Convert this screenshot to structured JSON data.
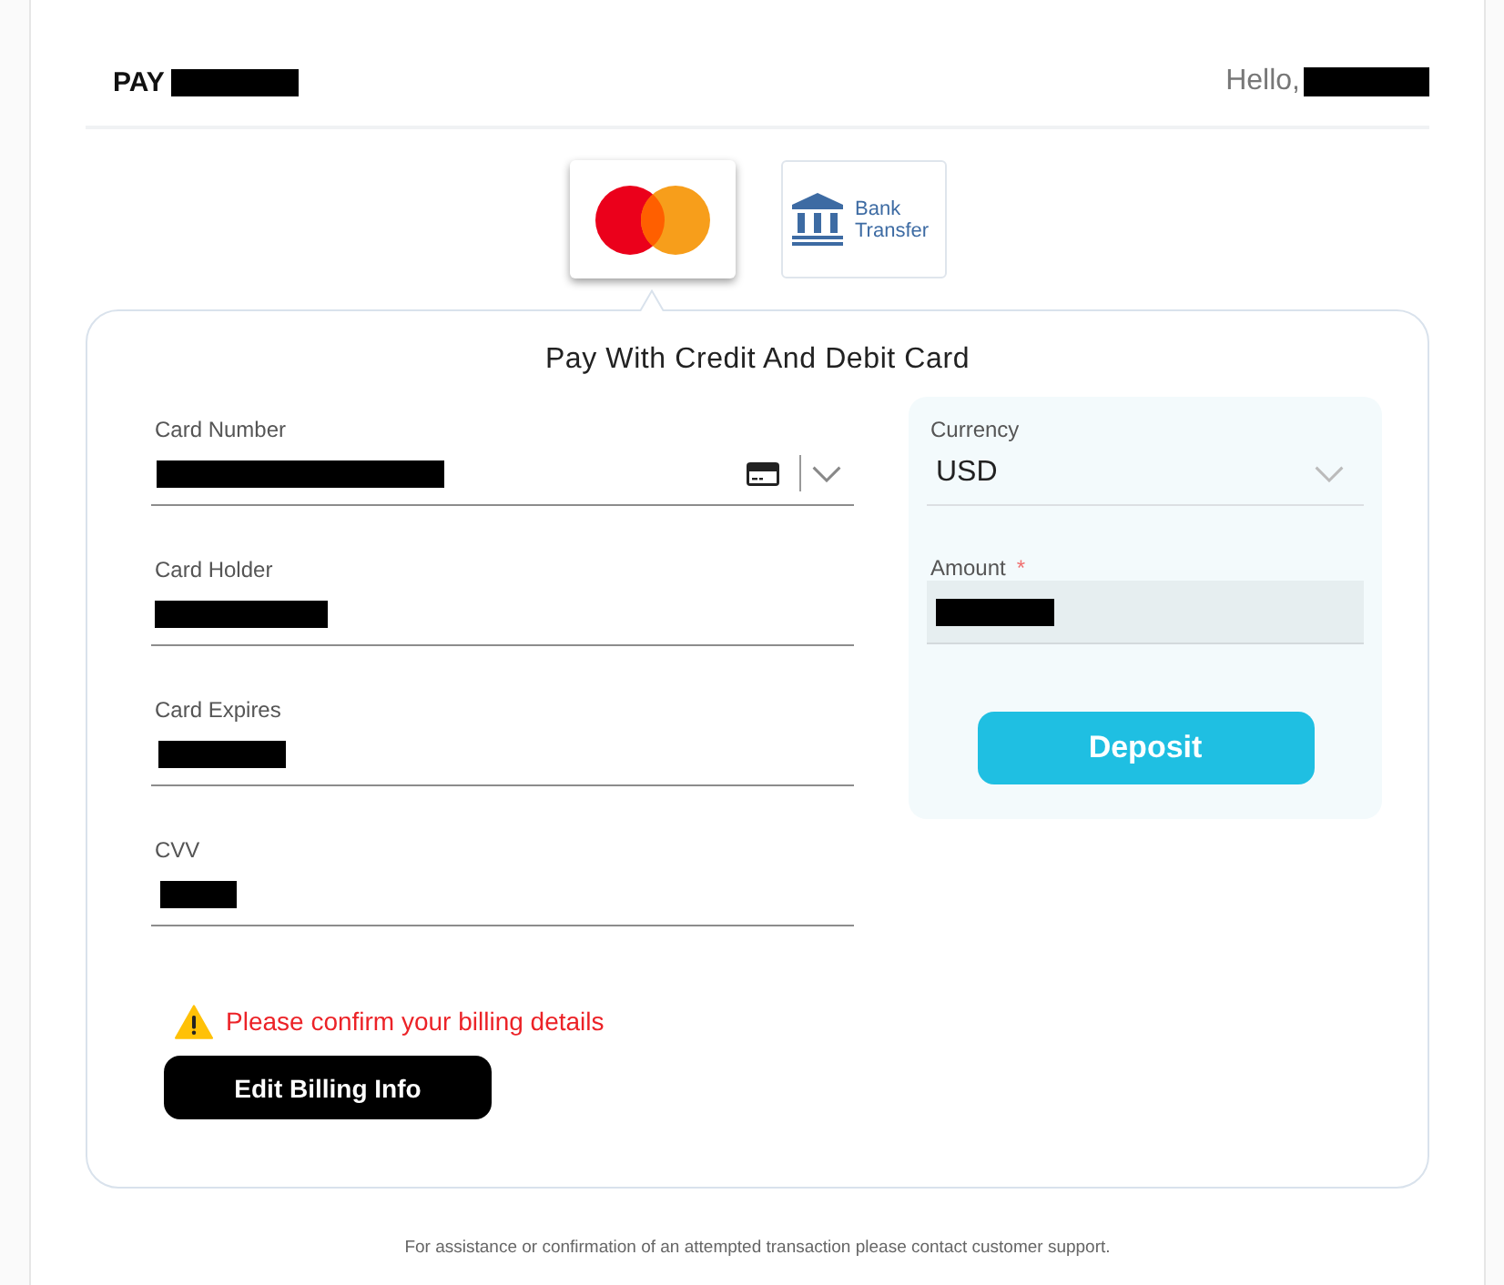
{
  "header": {
    "title": {
      "text": "PAY",
      "redacted": true
    },
    "greeting": {
      "text": "Hello,",
      "redacted": true
    }
  },
  "payment_methods": [
    {
      "kind": "card",
      "selected": true
    },
    {
      "kind": "bank",
      "label": "Bank Transfer",
      "selected": false
    }
  ],
  "card_form": {
    "title": "Pay With Credit And Debit Card",
    "fields": [
      {
        "kind": "card-number",
        "label": "Card Number",
        "redacted": true
      },
      {
        "kind": "text",
        "label": "Card Holder",
        "redacted": true
      },
      {
        "kind": "text",
        "label": "Card Expires",
        "redacted": true
      },
      {
        "kind": "text",
        "label": "CVV",
        "redacted": true
      }
    ],
    "alert": {
      "kind": "warning",
      "text": "Please confirm your billing details"
    },
    "edit_button": "Edit Billing Info"
  },
  "deposit_panel": {
    "currency": {
      "label": "Currency",
      "value": "USD"
    },
    "amount": {
      "label": "Amount",
      "required_mark": "*",
      "redacted": true
    },
    "button": "Deposit"
  },
  "footer": "For assistance or confirmation of an attempted transaction please contact customer support."
}
